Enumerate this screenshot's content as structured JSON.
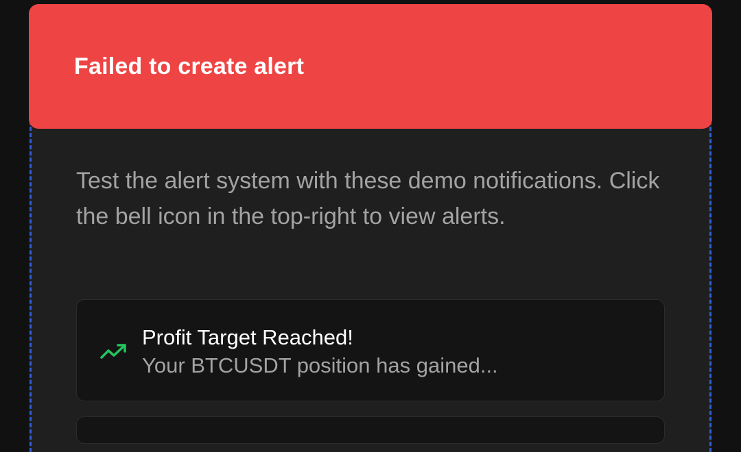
{
  "toast": {
    "message": "Failed to create alert",
    "color": "#ef4444"
  },
  "panel": {
    "description": "Test the alert system with these demo notifications. Click the bell icon in the top-right to view alerts."
  },
  "alerts": [
    {
      "title": "Profit Target Reached!",
      "subtitle": "Your BTCUSDT position has gained...",
      "icon": "trending-up-icon",
      "icon_color": "#22c55e"
    }
  ],
  "colors": {
    "background": "#111111",
    "panel": "#1f1f1f",
    "card": "#141414",
    "dashed_border": "#2f5fd6"
  }
}
